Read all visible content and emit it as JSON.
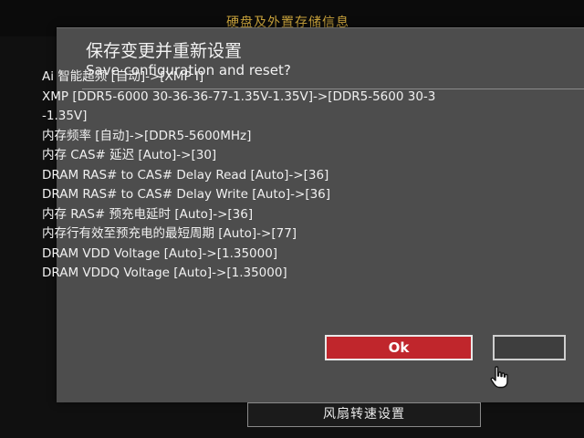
{
  "background_header": {
    "title": "硬盘及外置存储信息"
  },
  "dialog": {
    "title": "保存变更并重新设置",
    "subtitle": "Save configuration and reset?",
    "changes": [
      "Ai 智能超频 [自动]->[XMP I]",
      "XMP [DDR5-6000 30-36-36-77-1.35V-1.35V]->[DDR5-5600 30-3",
      "-1.35V]",
      "内存频率 [自动]->[DDR5-5600MHz]",
      "内存 CAS# 延迟 [Auto]->[30]",
      "DRAM RAS# to CAS# Delay Read [Auto]->[36]",
      "DRAM RAS# to CAS# Delay Write [Auto]->[36]",
      "内存 RAS# 预充电延时 [Auto]->[36]",
      "内存行有效至预充电的最短周期 [Auto]->[77]",
      "DRAM VDD Voltage [Auto]->[1.35000]",
      "DRAM VDDQ Voltage [Auto]->[1.35000]"
    ],
    "ok_label": "Ok"
  },
  "bottom_bar": {
    "fan_label": "风扇转速设置"
  },
  "colors": {
    "accent": "#c0262c",
    "dialog_bg": "#4d4d4d",
    "header_text": "#c9a33c"
  },
  "icons": {
    "cursor": "hand-pointer-icon"
  }
}
